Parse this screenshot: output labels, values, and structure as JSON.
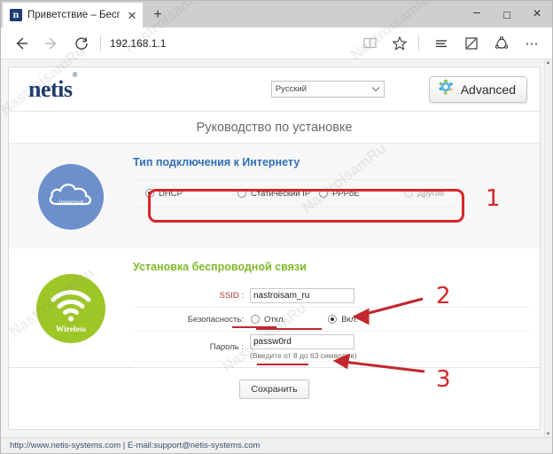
{
  "browser": {
    "tab": {
      "title": "Приветствие – Беспров",
      "close_label": "✕",
      "favicon_name": "netis-favicon"
    },
    "new_tab_label": "+",
    "window_controls": {
      "minimize": "–",
      "maximize": "□",
      "close": "✕"
    },
    "nav": {
      "back": "←",
      "forward": "→",
      "refresh": "↻",
      "url": "192.168.1.1",
      "reading_view": "book-icon",
      "favorites": "star-icon",
      "hub": "hub-icon",
      "make_note": "note-icon",
      "share": "share-icon",
      "more": "⋯"
    }
  },
  "router": {
    "logo": "netis",
    "logo_mark": "®",
    "language": {
      "value": "Русский",
      "caret": "⌄"
    },
    "advanced_label": "Advanced",
    "page_title": "Руководство по установке",
    "internet": {
      "heading": "Тип подключения к Интернету",
      "icon_caption": "internet",
      "options": [
        {
          "label": "DHCP",
          "selected": true,
          "disabled": false
        },
        {
          "label": "Статический IP",
          "selected": false,
          "disabled": false
        },
        {
          "label": "PPPoE",
          "selected": false,
          "disabled": false
        },
        {
          "label": "Другие",
          "selected": false,
          "disabled": true
        }
      ]
    },
    "wireless": {
      "heading": "Установка беспроводной связи",
      "icon_caption": "Wireless",
      "ssid_label": "SSID :",
      "ssid_value": "nastroisam_ru",
      "security_label": "Безопасность:",
      "security_options": [
        {
          "label": "Откл.",
          "selected": false
        },
        {
          "label": "Вкл.",
          "selected": true
        }
      ],
      "password_label": "Пароль :",
      "password_value": "passw0rd",
      "password_hint": "(Введите от 8 до 63 символов)"
    },
    "save_label": "Сохранить",
    "footer": "http://www.netis-systems.com | E-mail:support@netis-systems.com"
  },
  "annotations": {
    "one": "1",
    "two": "2",
    "three": "3"
  },
  "watermarks": [
    "NastroisamRu",
    "NastroisamRu",
    "NastroisamRu",
    "NastroisamRu",
    "NastroisamRu",
    "NastroisamRu"
  ],
  "colors": {
    "accent_blue": "#2f6fb8",
    "accent_green": "#7fb92a",
    "logo_navy": "#1e3a6d",
    "annotation_red": "#d8262b",
    "icon_blue": "#6d8fcb",
    "icon_green": "#9dc727"
  }
}
